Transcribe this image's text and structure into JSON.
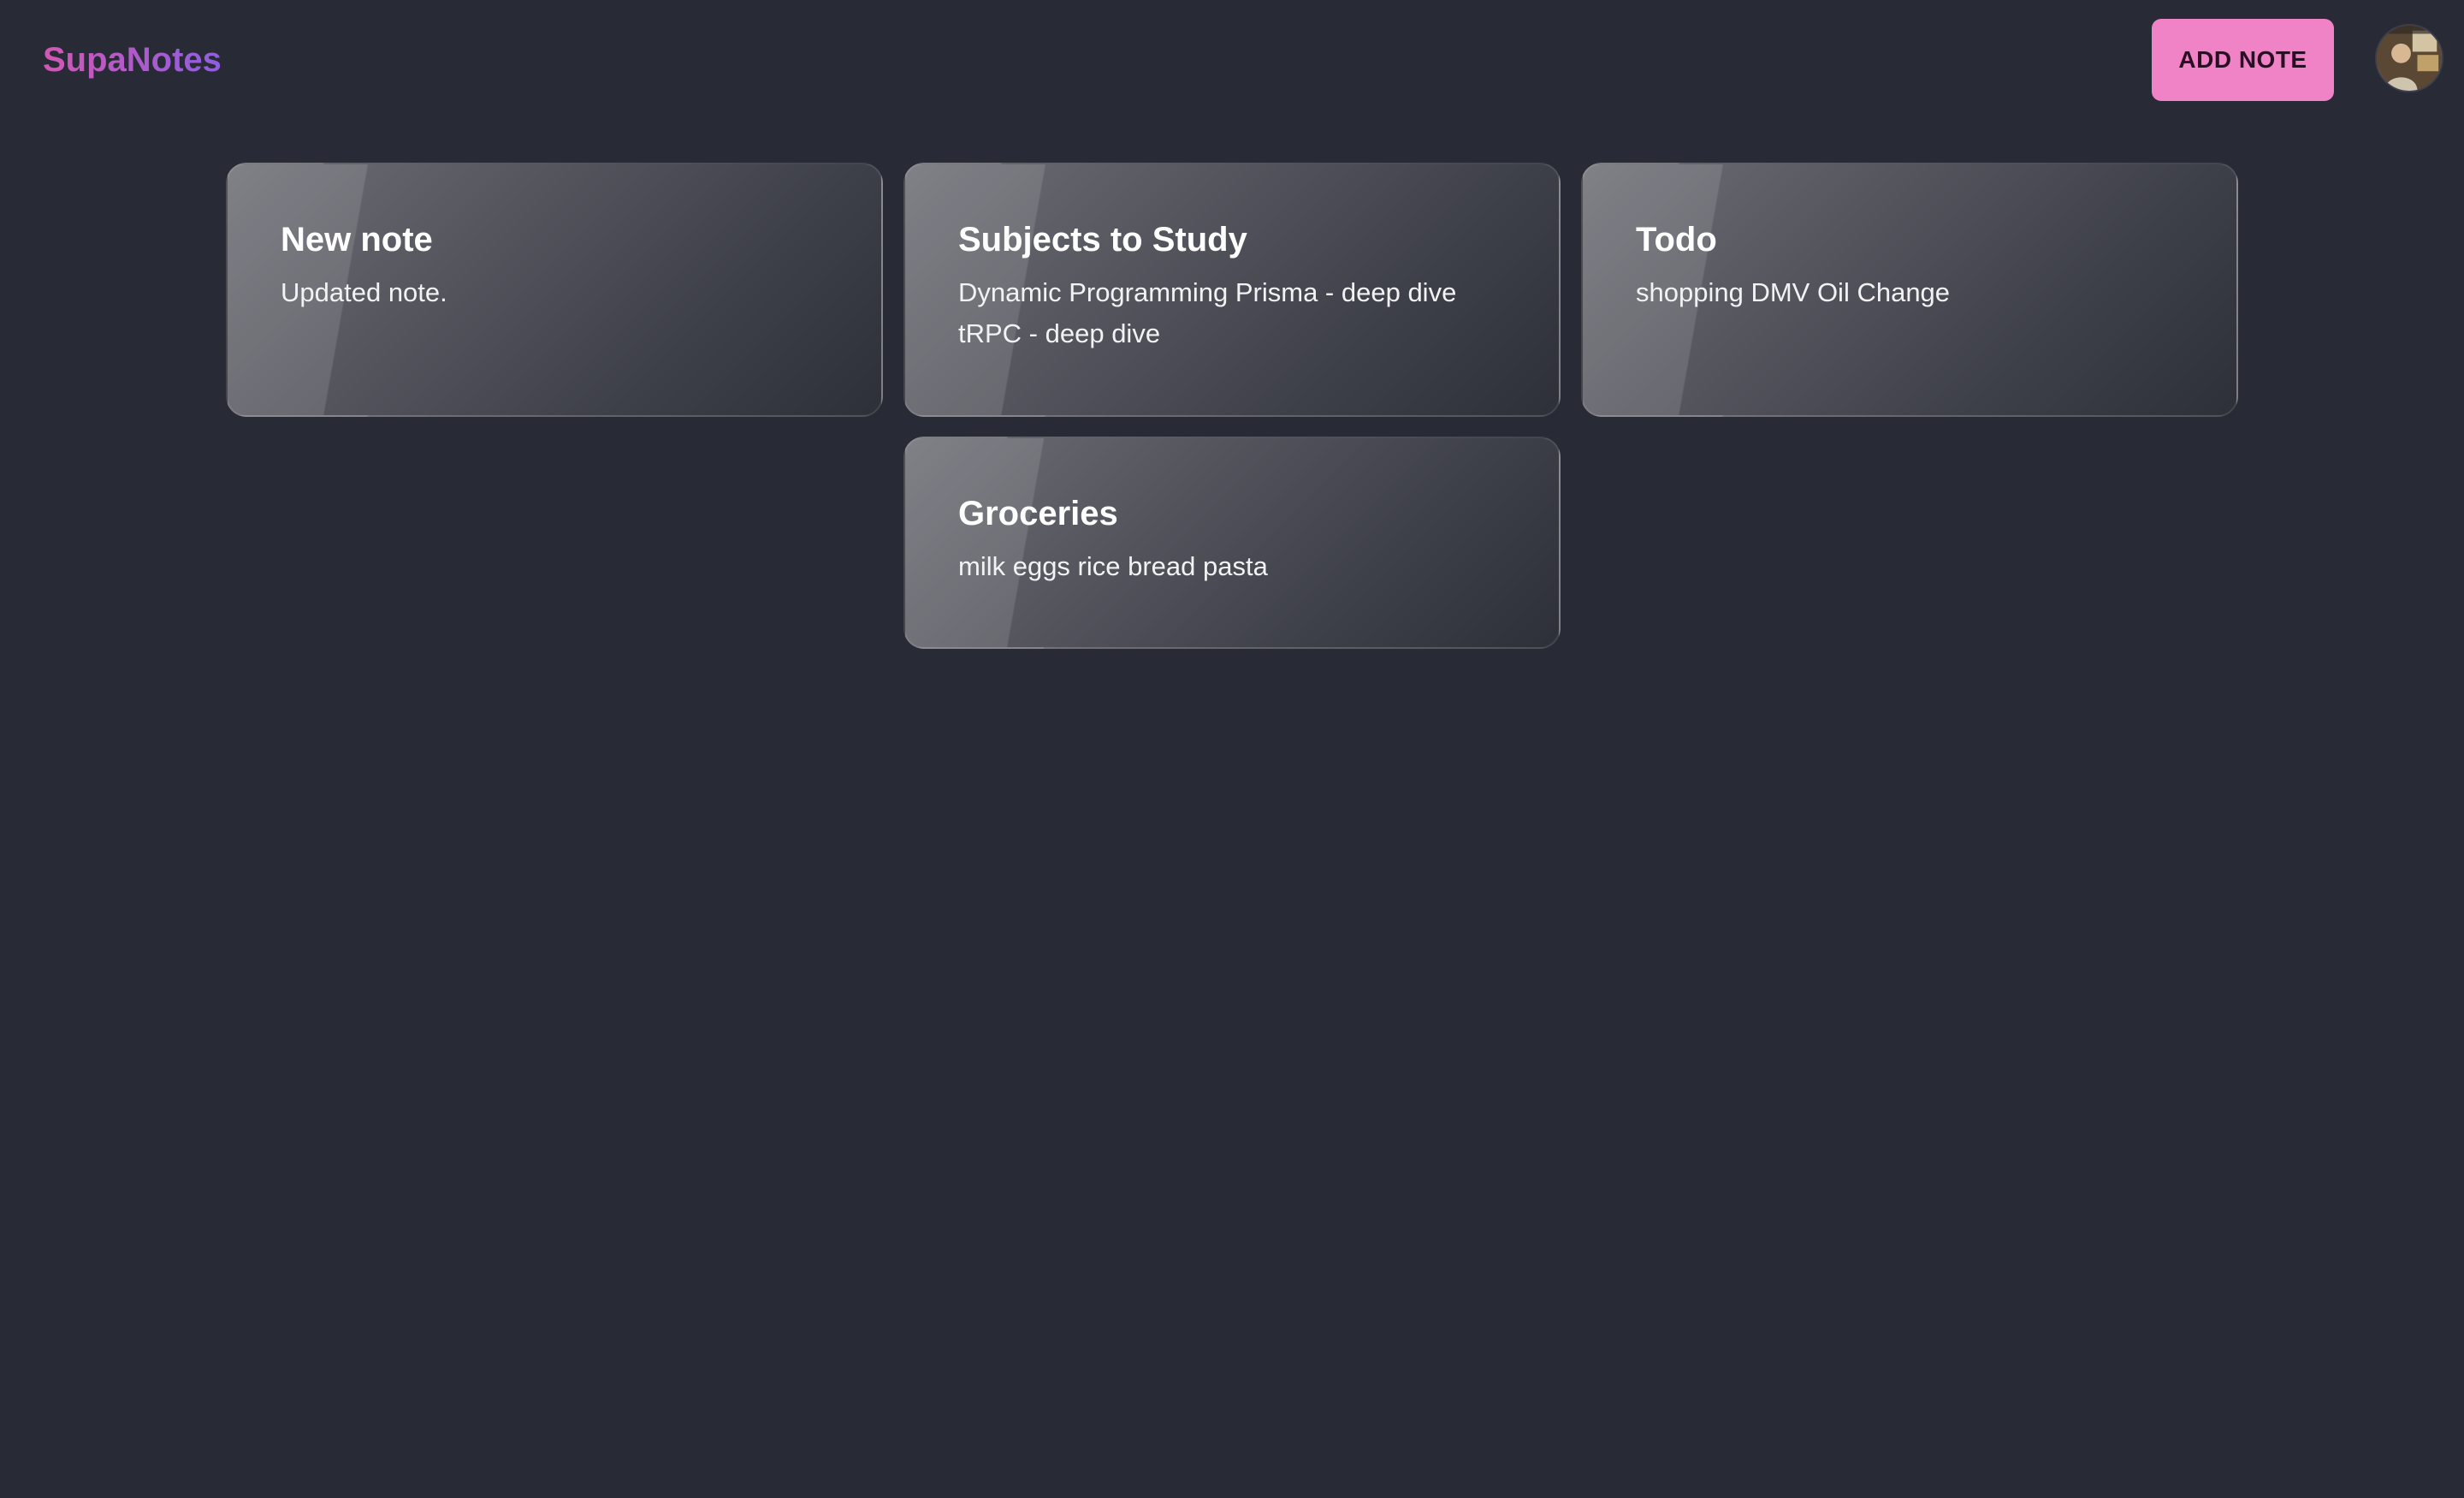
{
  "app": {
    "brand": "SupaNotes",
    "brand_gradient": [
      "#d257b4",
      "#8e5ee0"
    ],
    "background": "#282a36"
  },
  "header": {
    "add_note_label": "ADD NOTE",
    "add_note_color": "#ef83c6",
    "avatar_icon": "user-avatar-photo"
  },
  "notes": [
    {
      "title": "New note",
      "body": "Updated note."
    },
    {
      "title": "Subjects to Study",
      "body": "Dynamic Programming Prisma - deep dive\ntRPC - deep dive"
    },
    {
      "title": "Todo",
      "body": "shopping DMV Oil Change"
    },
    {
      "title": "Groceries",
      "body": "milk eggs rice bread pasta"
    }
  ]
}
